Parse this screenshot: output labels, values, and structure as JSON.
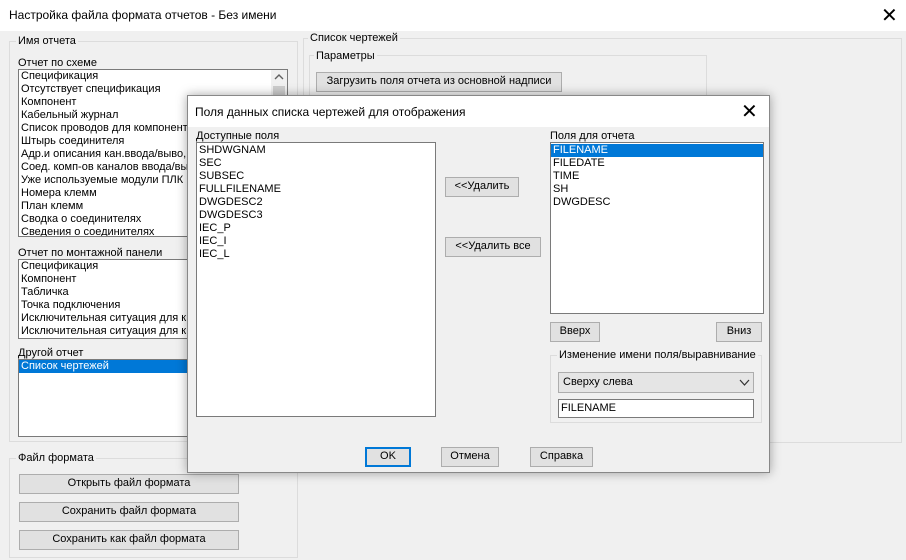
{
  "window": {
    "title": "Настройка файла формата отчетов - Без имени",
    "close_symbol": "✕"
  },
  "report_name_group": {
    "label": "Имя отчета",
    "schematic": {
      "label": "Отчет по схеме",
      "items": [
        "Спецификация",
        "Отсутствует спецификация",
        "Компонент",
        "Кабельный журнал",
        "Список проводов для компонент",
        "Штырь соединителя",
        "Адр.и описания кан.ввода/выво,",
        "Соед. комп-ов каналов ввода/вы",
        "Уже используемые модули ПЛК",
        "Номера клемм",
        "План клемм",
        "Сводка о соединителях",
        "Сведения о соединителях"
      ]
    },
    "panel": {
      "label": "Отчет по монтажной панели",
      "items": [
        "Спецификация",
        "Компонент",
        "Табличка",
        "Точка подключения",
        "Исключительная ситуация для к",
        "Исключительная ситуация для к"
      ]
    },
    "other": {
      "label": "Другой отчет",
      "items": [
        "Список чертежей"
      ],
      "selected_index": 0
    }
  },
  "format_file_group": {
    "label": "Файл формата",
    "open_label": "Открыть файл формата",
    "save_label": "Сохранить файл формата",
    "save_as_label": "Сохранить как файл формата"
  },
  "drawing_list_group": {
    "label": "Список чертежей",
    "params_label": "Параметры",
    "load_fields_label": "Загрузить поля отчета из основной надписи"
  },
  "dialog": {
    "title": "Поля данных списка чертежей для отображения",
    "close_symbol": "✕",
    "available": {
      "label": "Доступные поля",
      "items": [
        "SHDWGNAM",
        "SEC",
        "SUBSEC",
        "FULLFILENAME",
        "DWGDESC2",
        "DWGDESC3",
        "IEC_P",
        "IEC_I",
        "IEC_L"
      ]
    },
    "report": {
      "label": "Поля для отчета",
      "items": [
        "FILENAME",
        "FILEDATE",
        "TIME",
        "SH",
        "DWGDESC"
      ],
      "selected_index": 0
    },
    "remove_label": "<<Удалить",
    "remove_all_label": "<<Удалить все",
    "up_label": "Вверх",
    "down_label": "Вниз",
    "rename_group_label": "Изменение имени поля/выравнивание",
    "alignment_value": "Сверху слева",
    "field_name_value": "FILENAME",
    "ok_label": "OK",
    "cancel_label": "Отмена",
    "help_label": "Справка"
  }
}
